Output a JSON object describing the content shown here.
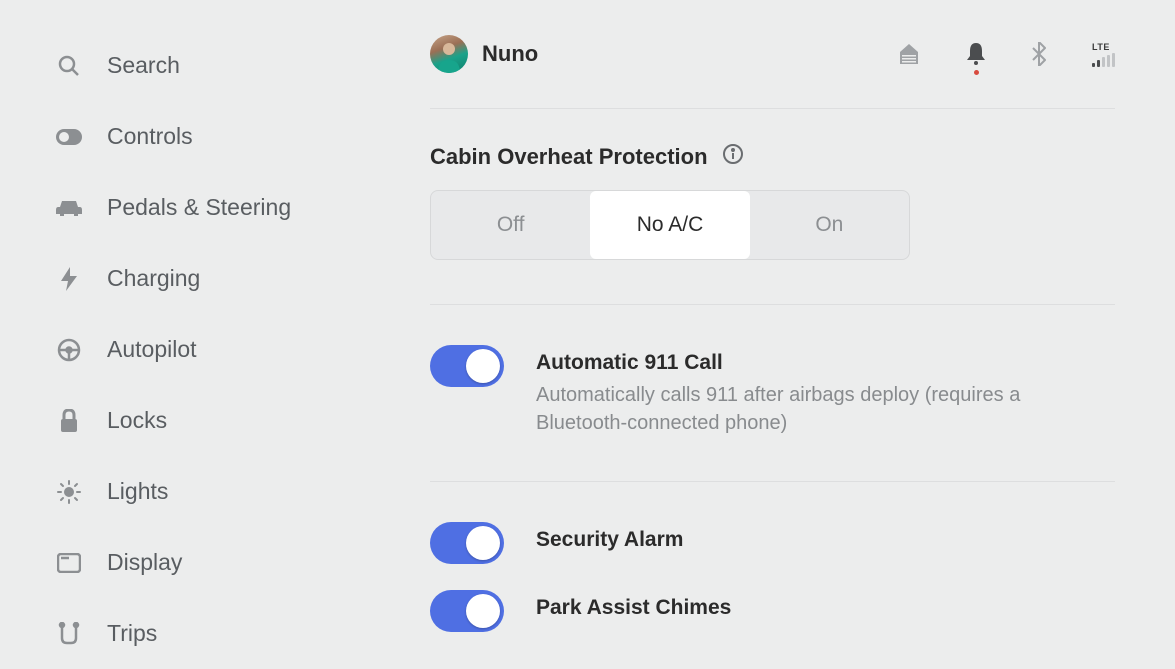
{
  "sidebar": {
    "items": [
      {
        "label": "Search"
      },
      {
        "label": "Controls"
      },
      {
        "label": "Pedals & Steering"
      },
      {
        "label": "Charging"
      },
      {
        "label": "Autopilot"
      },
      {
        "label": "Locks"
      },
      {
        "label": "Lights"
      },
      {
        "label": "Display"
      },
      {
        "label": "Trips"
      }
    ]
  },
  "header": {
    "username": "Nuno",
    "signal_label": "LTE"
  },
  "cabin_overheat": {
    "title": "Cabin Overheat Protection",
    "options": [
      "Off",
      "No A/C",
      "On"
    ],
    "selected": "No A/C"
  },
  "toggles": {
    "auto911": {
      "title": "Automatic 911 Call",
      "desc": "Automatically calls 911 after airbags deploy (requires a Bluetooth-connected phone)",
      "on": true
    },
    "security_alarm": {
      "title": "Security Alarm",
      "on": true
    },
    "park_assist": {
      "title": "Park Assist Chimes",
      "on": true
    }
  }
}
